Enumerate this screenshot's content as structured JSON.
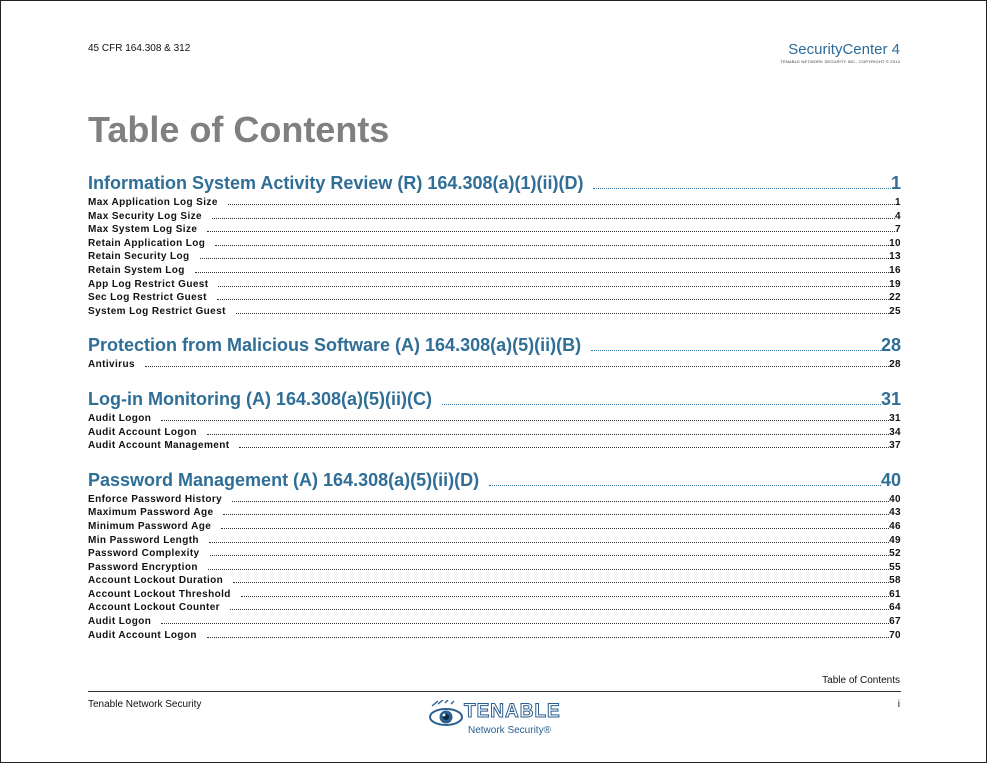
{
  "header": {
    "doc_ref": "45 CFR 164.308 & 312",
    "brand": "SecurityCenter 4",
    "copyright": "TENABLE NETWORK SECURITY INC., COPYRIGHT © 2013"
  },
  "title": "Table of Contents",
  "sections": [
    {
      "title": "Information System Activity Review (R) 164.308(a)(1)(ii)(D)",
      "page": "1",
      "entries": [
        {
          "label": "Max Application Log Size",
          "page": "1"
        },
        {
          "label": "Max Security Log Size",
          "page": "4"
        },
        {
          "label": "Max System Log Size",
          "page": "7"
        },
        {
          "label": "Retain Application Log",
          "page": "10"
        },
        {
          "label": "Retain Security Log",
          "page": "13"
        },
        {
          "label": "Retain System Log",
          "page": "16"
        },
        {
          "label": "App Log Restrict Guest",
          "page": "19"
        },
        {
          "label": "Sec Log Restrict Guest",
          "page": "22"
        },
        {
          "label": "System Log Restrict Guest",
          "page": "25"
        }
      ]
    },
    {
      "title": "Protection from Malicious Software (A) 164.308(a)(5)(ii)(B)",
      "page": "28",
      "entries": [
        {
          "label": "Antivirus",
          "page": "28"
        }
      ]
    },
    {
      "title": "Log-in Monitoring (A) 164.308(a)(5)(ii)(C)",
      "page": "31",
      "entries": [
        {
          "label": "Audit Logon",
          "page": "31"
        },
        {
          "label": "Audit Account Logon",
          "page": "34"
        },
        {
          "label": "Audit Account Management",
          "page": "37"
        }
      ]
    },
    {
      "title": "Password Management (A) 164.308(a)(5)(ii)(D)",
      "page": "40",
      "entries": [
        {
          "label": "Enforce Password History",
          "page": "40"
        },
        {
          "label": "Maximum Password Age",
          "page": "43"
        },
        {
          "label": "Minimum Password Age",
          "page": "46"
        },
        {
          "label": "Min Password Length",
          "page": "49"
        },
        {
          "label": "Password Complexity",
          "page": "52"
        },
        {
          "label": "Password Encryption",
          "page": "55"
        },
        {
          "label": "Account Lockout Duration",
          "page": "58"
        },
        {
          "label": "Account Lockout Threshold",
          "page": "61"
        },
        {
          "label": "Account Lockout Counter",
          "page": "64"
        },
        {
          "label": "Audit Logon",
          "page": "67"
        },
        {
          "label": "Audit Account Logon",
          "page": "70"
        }
      ]
    }
  ],
  "footer": {
    "section_label": "Table of Contents",
    "company": "Tenable Network Security",
    "page_number": "i",
    "logo_word": "TENABLE",
    "logo_sub": "Network Security®"
  },
  "colors": {
    "heading_blue": "#2f6e96",
    "title_gray": "#808080"
  },
  "icons": {
    "logo": "tenable-eye-logo"
  }
}
